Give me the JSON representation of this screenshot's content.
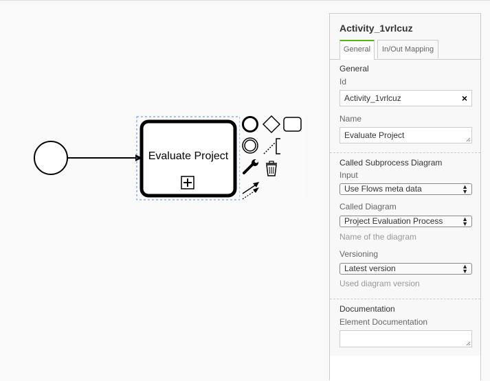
{
  "canvas": {
    "task": {
      "label": "Evaluate Project"
    },
    "icons": {
      "start_event": "start-event-icon",
      "gateway": "gateway-icon",
      "task": "task-icon",
      "intermediate_event": "intermediate-event-icon",
      "text_annotation": "text-annotation-icon",
      "wrench": "wrench-icon",
      "delete": "trash-icon",
      "connect": "connect-arrow-icon",
      "association": "association-arrow-icon",
      "subprocess_marker": "plus-square-icon"
    }
  },
  "panel": {
    "title": "Activity_1vrlcuz",
    "tabs": [
      {
        "label": "General",
        "active": true
      },
      {
        "label": "In/Out Mapping",
        "active": false
      }
    ],
    "general": {
      "heading": "General",
      "id_label": "Id",
      "id_value": "Activity_1vrlcuz",
      "name_label": "Name",
      "name_value": "Evaluate Project"
    },
    "called": {
      "heading": "Called Subprocess Diagram",
      "input_label": "Input",
      "input_value": "Use Flows meta data",
      "diagram_label": "Called Diagram",
      "diagram_value": "Project Evaluation Process",
      "diagram_hint": "Name of the diagram",
      "versioning_label": "Versioning",
      "versioning_value": "Latest version",
      "versioning_hint": "Used diagram version"
    },
    "documentation": {
      "heading": "Documentation",
      "element_label": "Element Documentation",
      "element_value": ""
    }
  },
  "colors": {
    "active_tab_accent": "#52b415",
    "selection_outline": "#4a90e2"
  }
}
